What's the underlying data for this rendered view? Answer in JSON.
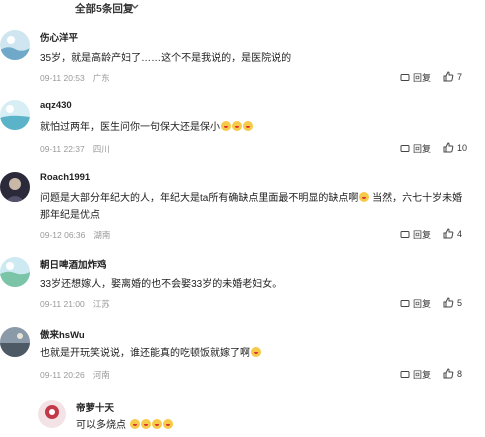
{
  "header": {
    "all_replies_label": "全部5条回复"
  },
  "comments": [
    {
      "user": "伤心洋平",
      "text": "35岁，就是高龄产妇了……这个不是我说的，是医院说的",
      "time": "09-11 20:53",
      "location": "广东",
      "reply_label": "回复",
      "likes": "7",
      "emojis": []
    },
    {
      "user": "aqz430",
      "text": "就怕过两年，医生问你一句保大还是保小",
      "time": "09-11 22:37",
      "location": "四川",
      "reply_label": "回复",
      "likes": "10",
      "emojis": [
        "grin",
        "grin",
        "grin"
      ]
    },
    {
      "user": "Roach1991",
      "text": "问题是大部分年纪大的人，年纪大是ta所有确缺点里面最不明显的缺点啊",
      "text2": "当然，六七十岁未婚那年纪是优点",
      "time": "09-12 06:36",
      "location": "湖南",
      "reply_label": "回复",
      "likes": "4",
      "emojis": [
        "grin"
      ]
    },
    {
      "user": "朝日啤酒加炸鸡",
      "text": "33岁还想嫁人，娶离婚的也不会娶33岁的未婚老妇女。",
      "time": "09-11 21:00",
      "location": "江苏",
      "reply_label": "回复",
      "likes": "5",
      "emojis": []
    },
    {
      "user": "傲来hsWu",
      "text": "也就是开玩笑说说，谁还能真的吃顿饭就嫁了啊",
      "time": "09-11 20:26",
      "location": "河南",
      "reply_label": "回复",
      "likes": "8",
      "emojis": [
        "grin"
      ]
    },
    {
      "user": "帝萝十天",
      "text": "可以多烧点",
      "emojis": [
        "grin",
        "grin",
        "grin",
        "grin"
      ]
    }
  ],
  "colors": {
    "meta": "#999999",
    "text": "#222222"
  },
  "icons": {
    "chevron": "chevron-down-icon",
    "reply": "reply-icon",
    "like": "thumbs-up-icon"
  }
}
